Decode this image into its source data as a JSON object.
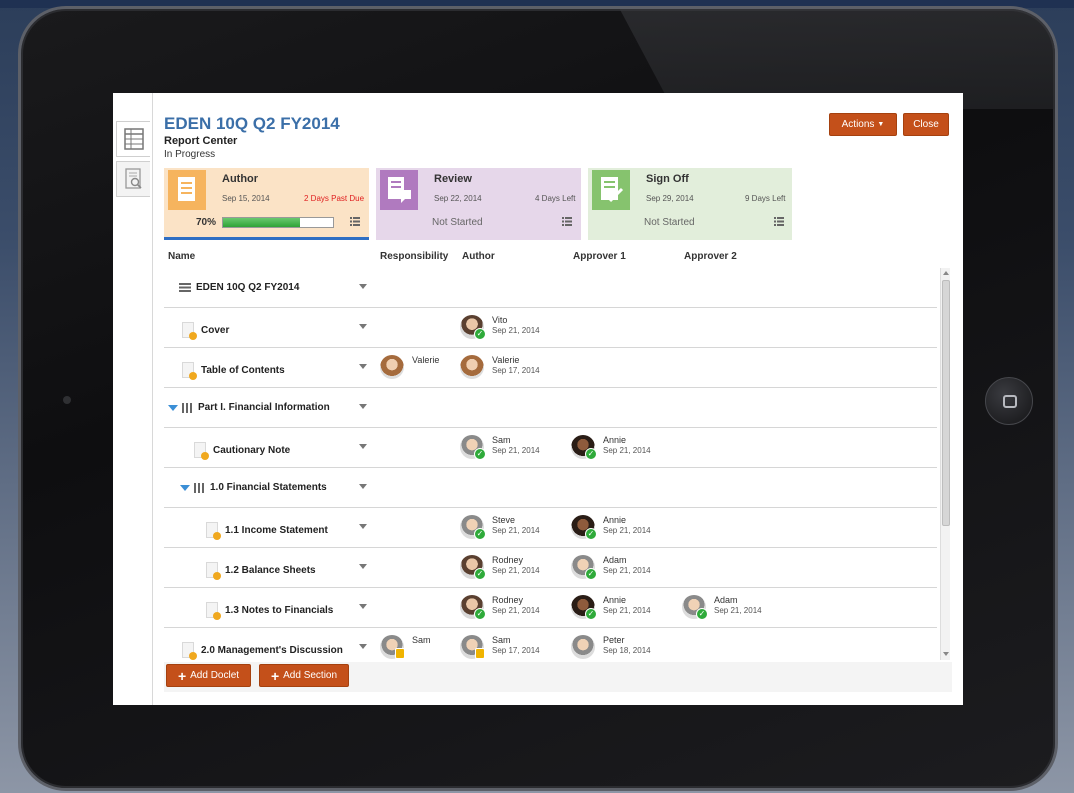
{
  "header": {
    "title": "EDEN 10Q Q2 FY2014",
    "subtitle": "Report Center",
    "status": "In Progress",
    "actions_label": "Actions",
    "close_label": "Close"
  },
  "stages": [
    {
      "name": "Author",
      "date": "Sep 15, 2014",
      "remaining": "2 Days Past Due",
      "progress_pct": 70,
      "progress_label": "70%"
    },
    {
      "name": "Review",
      "date": "Sep 22, 2014",
      "remaining": "4 Days Left",
      "state": "Not Started"
    },
    {
      "name": "Sign Off",
      "date": "Sep 29, 2014",
      "remaining": "9 Days Left",
      "state": "Not Started"
    }
  ],
  "table": {
    "columns": [
      "Name",
      "Responsibility",
      "Author",
      "Approver 1",
      "Approver 2"
    ],
    "rows": [
      {
        "name": "EDEN 10Q Q2 FY2014"
      },
      {
        "name": "Cover",
        "author": {
          "name": "Vito",
          "date": "Sep 21, 2014"
        }
      },
      {
        "name": "Table of Contents",
        "responsibility": "Valerie",
        "author": {
          "name": "Valerie",
          "date": "Sep 17, 2014"
        }
      },
      {
        "name": "Part I. Financial Information"
      },
      {
        "name": "Cautionary Note",
        "author": {
          "name": "Sam",
          "date": "Sep 21, 2014"
        },
        "approver1": {
          "name": "Annie",
          "date": "Sep 21, 2014"
        }
      },
      {
        "name": "1.0 Financial Statements"
      },
      {
        "name": "1.1 Income Statement",
        "author": {
          "name": "Steve",
          "date": "Sep 21, 2014"
        },
        "approver1": {
          "name": "Annie",
          "date": "Sep 21, 2014"
        }
      },
      {
        "name": "1.2 Balance Sheets",
        "author": {
          "name": "Rodney",
          "date": "Sep 21, 2014"
        },
        "approver1": {
          "name": "Adam",
          "date": "Sep 21, 2014"
        }
      },
      {
        "name": "1.3 Notes to Financials",
        "author": {
          "name": "Rodney",
          "date": "Sep 21, 2014"
        },
        "approver1": {
          "name": "Annie",
          "date": "Sep 21, 2014"
        },
        "approver2": {
          "name": "Adam",
          "date": "Sep 21, 2014"
        }
      },
      {
        "name": "2.0 Management's Discussion",
        "responsibility": "Sam",
        "author": {
          "name": "Sam",
          "date": "Sep 17, 2014"
        },
        "approver1": {
          "name": "Peter",
          "date": "Sep 18, 2014"
        }
      }
    ]
  },
  "footer": {
    "add_doclet_label": "Add Doclet",
    "add_section_label": "Add Section"
  },
  "colors": {
    "title_blue": "#3b6fa8",
    "author_stage": "#fbe3c6",
    "review_stage": "#e6d7ea",
    "signoff_stage": "#e2eedb",
    "button_orange": "#c4501a"
  }
}
